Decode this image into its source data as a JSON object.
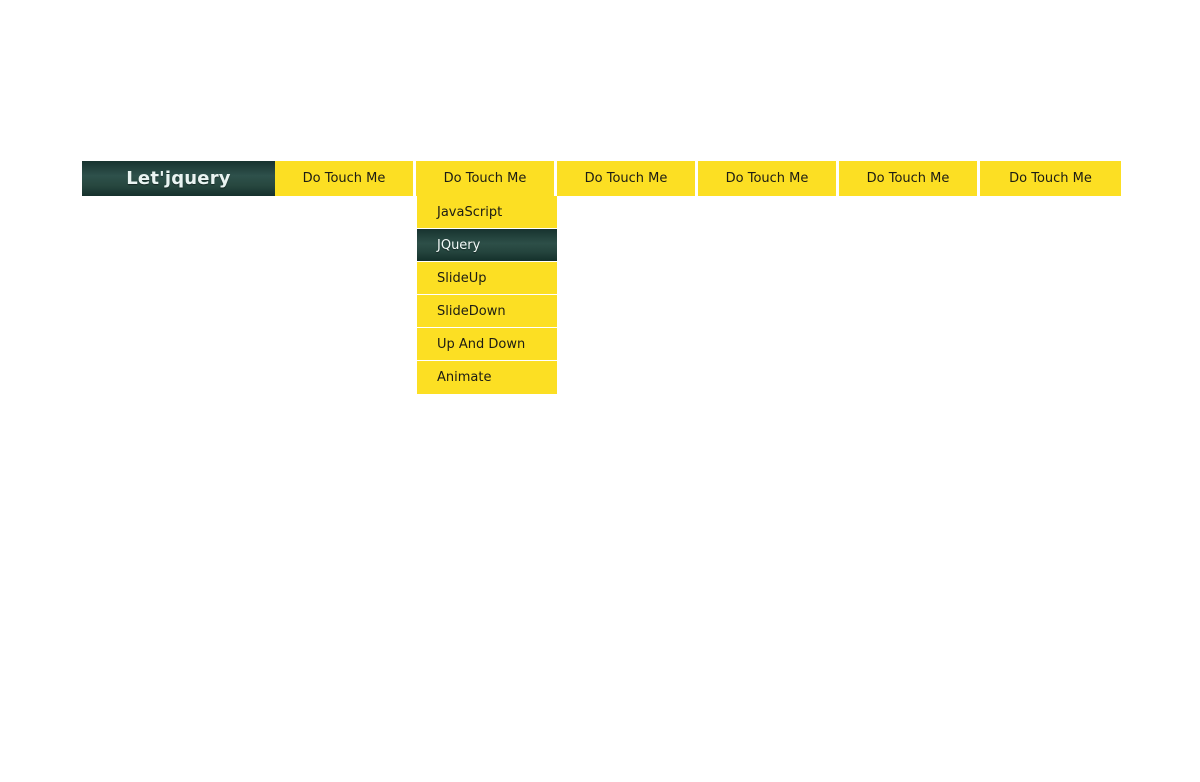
{
  "page": {
    "background_color": "#ffffff"
  },
  "menubar": {
    "brand_label": "Let'jquery",
    "brand_color": "#22443e",
    "item_color": "#fcdf23",
    "items": [
      {
        "label": "Do Touch Me"
      },
      {
        "label": "Do Touch Me"
      },
      {
        "label": "Do Touch Me"
      },
      {
        "label": "Do Touch Me"
      },
      {
        "label": "Do Touch Me"
      },
      {
        "label": "Do Touch Me"
      }
    ]
  },
  "dropdown": {
    "parent_index": 1,
    "active_label": "JQuery",
    "active_color": "#22443e",
    "items": [
      {
        "label": "JavaScript",
        "active": false
      },
      {
        "label": "JQuery",
        "active": true
      },
      {
        "label": "SlideUp",
        "active": false
      },
      {
        "label": "SlideDown",
        "active": false
      },
      {
        "label": "Up And Down",
        "active": false
      },
      {
        "label": "Animate",
        "active": false
      }
    ]
  }
}
